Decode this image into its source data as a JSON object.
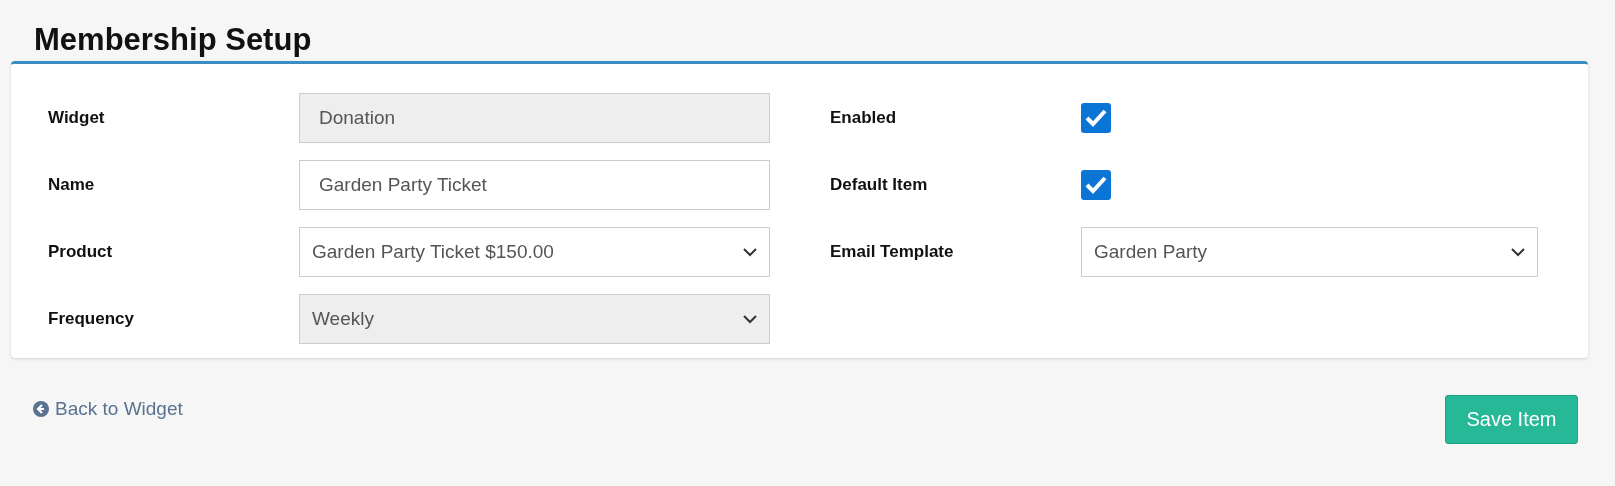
{
  "title": "Membership Setup",
  "left_fields": [
    {
      "label": "Widget",
      "kind": "text",
      "value": "Donation",
      "disabled": true
    },
    {
      "label": "Name",
      "kind": "text",
      "value": "Garden Party Ticket",
      "disabled": false
    },
    {
      "label": "Product",
      "kind": "select",
      "value": "Garden Party Ticket $150.00",
      "disabled": false
    },
    {
      "label": "Frequency",
      "kind": "select",
      "value": "Weekly",
      "disabled": true
    }
  ],
  "right_fields": [
    {
      "label": "Enabled",
      "kind": "checkbox",
      "checked": true
    },
    {
      "label": "Default Item",
      "kind": "checkbox",
      "checked": true
    },
    {
      "label": "Email Template",
      "kind": "select",
      "value": "Garden Party",
      "disabled": false
    }
  ],
  "back_link": "Back to Widget",
  "save_button": "Save Item"
}
